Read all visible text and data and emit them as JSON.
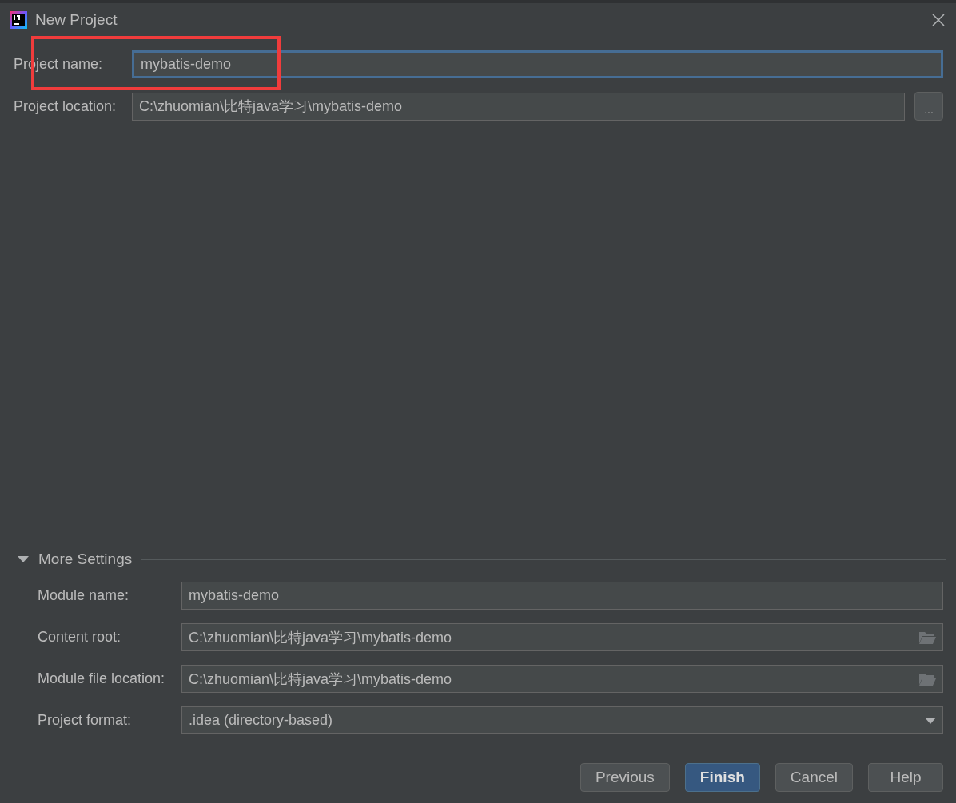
{
  "window": {
    "title": "New Project"
  },
  "fields": [
    {
      "label": "Project name:",
      "value": "mybatis-demo",
      "kind": "text",
      "focused": true,
      "highlighted": true
    },
    {
      "label": "Project location:",
      "value": "C:\\zhuomian\\比特java学习\\mybatis-demo",
      "kind": "browse",
      "focused": false,
      "button": "..."
    }
  ],
  "more_settings": {
    "label": "More Settings",
    "expanded": true,
    "fields": [
      {
        "label": "Module name:",
        "value": "mybatis-demo",
        "kind": "text"
      },
      {
        "label": "Content root:",
        "value": "C:\\zhuomian\\比特java学习\\mybatis-demo",
        "kind": "folder"
      },
      {
        "label": "Module file location:",
        "value": "C:\\zhuomian\\比特java学习\\mybatis-demo",
        "kind": "folder"
      },
      {
        "label": "Project format:",
        "value": ".idea (directory-based)",
        "kind": "select"
      }
    ]
  },
  "buttons": [
    {
      "label": "Previous",
      "primary": false
    },
    {
      "label": "Finish",
      "primary": true
    },
    {
      "label": "Cancel",
      "primary": false
    },
    {
      "label": "Help",
      "primary": false
    }
  ]
}
